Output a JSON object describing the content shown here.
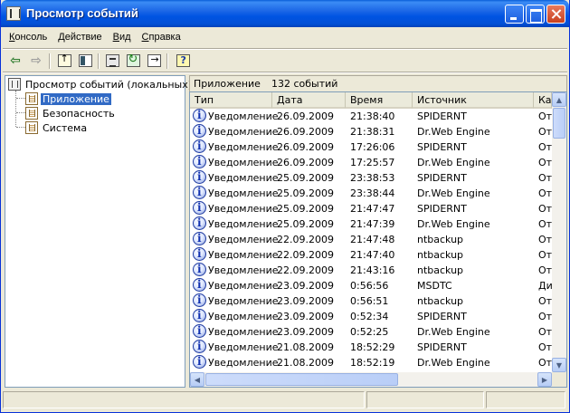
{
  "window": {
    "title": "Просмотр событий"
  },
  "menu": {
    "items": [
      {
        "underline": "К",
        "rest": "онсоль"
      },
      {
        "underline": "Д",
        "rest": "ействие"
      },
      {
        "underline": "В",
        "rest": "ид"
      },
      {
        "underline": "С",
        "rest": "правка"
      }
    ]
  },
  "toolbar": {
    "icons": [
      "back-arrow-icon",
      "forward-arrow-icon",
      "up-folder-icon",
      "show-hide-tree-icon",
      "properties-icon",
      "refresh-icon",
      "export-list-icon",
      "help-icon"
    ]
  },
  "tree": {
    "root": "Просмотр событий (локальных)",
    "children": [
      "Приложение",
      "Безопасность",
      "Система"
    ],
    "selected_index": 0
  },
  "list_header": {
    "name": "Приложение",
    "count": "132 событий"
  },
  "table": {
    "columns": [
      "Тип",
      "Дата",
      "Время",
      "Источник",
      "Ка"
    ],
    "rows": [
      [
        "Уведомление",
        "26.09.2009",
        "21:38:40",
        "SPIDERNT",
        "От"
      ],
      [
        "Уведомление",
        "26.09.2009",
        "21:38:31",
        "Dr.Web Engine",
        "От"
      ],
      [
        "Уведомление",
        "26.09.2009",
        "17:26:06",
        "SPIDERNT",
        "От"
      ],
      [
        "Уведомление",
        "26.09.2009",
        "17:25:57",
        "Dr.Web Engine",
        "От"
      ],
      [
        "Уведомление",
        "25.09.2009",
        "23:38:53",
        "SPIDERNT",
        "От"
      ],
      [
        "Уведомление",
        "25.09.2009",
        "23:38:44",
        "Dr.Web Engine",
        "От"
      ],
      [
        "Уведомление",
        "25.09.2009",
        "21:47:47",
        "SPIDERNT",
        "От"
      ],
      [
        "Уведомление",
        "25.09.2009",
        "21:47:39",
        "Dr.Web Engine",
        "От"
      ],
      [
        "Уведомление",
        "22.09.2009",
        "21:47:48",
        "ntbackup",
        "От"
      ],
      [
        "Уведомление",
        "22.09.2009",
        "21:47:40",
        "ntbackup",
        "От"
      ],
      [
        "Уведомление",
        "22.09.2009",
        "21:43:16",
        "ntbackup",
        "От"
      ],
      [
        "Уведомление",
        "23.09.2009",
        "0:56:56",
        "MSDTC",
        "Ди"
      ],
      [
        "Уведомление",
        "23.09.2009",
        "0:56:51",
        "ntbackup",
        "От"
      ],
      [
        "Уведомление",
        "23.09.2009",
        "0:52:34",
        "SPIDERNT",
        "От"
      ],
      [
        "Уведомление",
        "23.09.2009",
        "0:52:25",
        "Dr.Web Engine",
        "От"
      ],
      [
        "Уведомление",
        "21.08.2009",
        "18:52:29",
        "SPIDERNT",
        "От"
      ],
      [
        "Уведомление",
        "21.08.2009",
        "18:52:19",
        "Dr.Web Engine",
        "От"
      ]
    ]
  }
}
